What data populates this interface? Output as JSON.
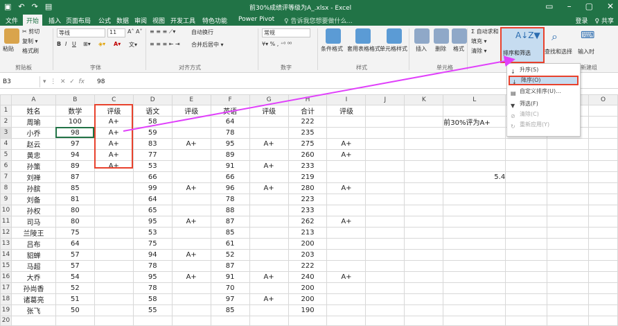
{
  "window": {
    "title": "前30%成绩评等级为A_.xlsx - Excel"
  },
  "tabs": [
    "文件",
    "开始",
    "插入",
    "页面布局",
    "公式",
    "数据",
    "审阅",
    "视图",
    "开发工具",
    "特色功能",
    "Power Pivot",
    "♀ 告诉我您想要做什么..."
  ],
  "account": {
    "login": "登录",
    "share": "♀ 共享"
  },
  "ribbon": {
    "cut": "✂ 剪切",
    "copy": "复制 ▾",
    "paste": "粘贴",
    "format_painter": "格式刷",
    "clipboard": "剪贴板",
    "font_name": "等线",
    "font_size": "11",
    "font_group": "字体",
    "wrap": "自动换行",
    "merge": "合并后居中 ▾",
    "align_group": "对齐方式",
    "number_format": "常规",
    "number_group": "数字",
    "cond_format": "条件格式",
    "table_format": "套用表格格式",
    "cell_style": "单元格样式",
    "styles_group": "样式",
    "insert": "插入",
    "delete": "删除",
    "format": "格式",
    "cells_group": "单元格",
    "autosum": "Σ 自动求和 ▾",
    "fill": "填充 ▾",
    "clear": "清除 ▾",
    "sort_filter": "排序和筛选",
    "find_select": "查找和选择",
    "edit_group": "编辑",
    "input_time": "输入时",
    "new_group": "新建组"
  },
  "formula_bar": {
    "name_box": "B3",
    "fx": "fx",
    "value": "98"
  },
  "dropdown": {
    "items": [
      {
        "label": "升序(S)",
        "enabled": true
      },
      {
        "label": "降序(O)",
        "enabled": true
      },
      {
        "label": "自定义排序(U)...",
        "enabled": true
      },
      {
        "label": "筛选(F)",
        "enabled": true
      },
      {
        "label": "清除(C)",
        "enabled": false
      },
      {
        "label": "重新应用(Y)",
        "enabled": false
      }
    ]
  },
  "columns": [
    "A",
    "B",
    "C",
    "D",
    "E",
    "F",
    "G",
    "H",
    "I",
    "J",
    "K",
    "L",
    "M",
    "N",
    "O"
  ],
  "rows": [
    [
      "姓名",
      "数学",
      "评级",
      "语文",
      "评级",
      "英语",
      "评级",
      "合计",
      "评级",
      "",
      "",
      "",
      "",
      ""
    ],
    [
      "周瑜",
      "100",
      "A+",
      "58",
      "",
      "64",
      "",
      "222",
      "",
      "",
      "",
      "前30%评为A+",
      "",
      ""
    ],
    [
      "小乔",
      "98",
      "A+",
      "59",
      "",
      "78",
      "",
      "235",
      "",
      "",
      "",
      "",
      "",
      ""
    ],
    [
      "赵云",
      "97",
      "A+",
      "83",
      "A+",
      "95",
      "A+",
      "275",
      "A+",
      "",
      "",
      "",
      "",
      ""
    ],
    [
      "黄忠",
      "94",
      "A+",
      "77",
      "",
      "89",
      "",
      "260",
      "A+",
      "",
      "",
      "",
      "",
      ""
    ],
    [
      "孙策",
      "89",
      "A+",
      "53",
      "",
      "91",
      "A+",
      "233",
      "",
      "",
      "",
      "",
      "",
      ""
    ],
    [
      "刘禅",
      "87",
      "",
      "66",
      "",
      "66",
      "",
      "219",
      "",
      "",
      "",
      "5.4",
      "",
      ""
    ],
    [
      "孙膑",
      "85",
      "",
      "99",
      "A+",
      "96",
      "A+",
      "280",
      "A+",
      "",
      "",
      "",
      "",
      ""
    ],
    [
      "刘备",
      "81",
      "",
      "64",
      "",
      "78",
      "",
      "223",
      "",
      "",
      "",
      "",
      "",
      ""
    ],
    [
      "孙权",
      "80",
      "",
      "65",
      "",
      "88",
      "",
      "233",
      "",
      "",
      "",
      "",
      "",
      ""
    ],
    [
      "司马",
      "80",
      "",
      "95",
      "A+",
      "87",
      "",
      "262",
      "A+",
      "",
      "",
      "",
      "",
      ""
    ],
    [
      "兰陵王",
      "75",
      "",
      "53",
      "",
      "85",
      "",
      "213",
      "",
      "",
      "",
      "",
      "",
      ""
    ],
    [
      "吕布",
      "64",
      "",
      "75",
      "",
      "61",
      "",
      "200",
      "",
      "",
      "",
      "",
      "",
      ""
    ],
    [
      "貂蝉",
      "57",
      "",
      "94",
      "A+",
      "52",
      "",
      "203",
      "",
      "",
      "",
      "",
      "",
      ""
    ],
    [
      "马超",
      "57",
      "",
      "78",
      "",
      "87",
      "",
      "222",
      "",
      "",
      "",
      "",
      "",
      ""
    ],
    [
      "大乔",
      "54",
      "",
      "95",
      "A+",
      "91",
      "A+",
      "240",
      "A+",
      "",
      "",
      "",
      "",
      ""
    ],
    [
      "孙尚香",
      "52",
      "",
      "78",
      "",
      "70",
      "",
      "200",
      "",
      "",
      "",
      "",
      "",
      ""
    ],
    [
      "诸葛亮",
      "51",
      "",
      "58",
      "",
      "97",
      "A+",
      "200",
      "",
      "",
      "",
      "",
      "",
      ""
    ],
    [
      "张飞",
      "50",
      "",
      "55",
      "",
      "85",
      "",
      "190",
      "",
      "",
      "",
      "",
      "",
      ""
    ],
    [
      "",
      "",
      "",
      "",
      "",
      "",
      "",
      "",
      "",
      "",
      "",
      "",
      "",
      ""
    ]
  ],
  "colors": {
    "excel_green": "#217346",
    "highlight_red": "#e8412c",
    "arrow_magenta": "#e040fb"
  }
}
